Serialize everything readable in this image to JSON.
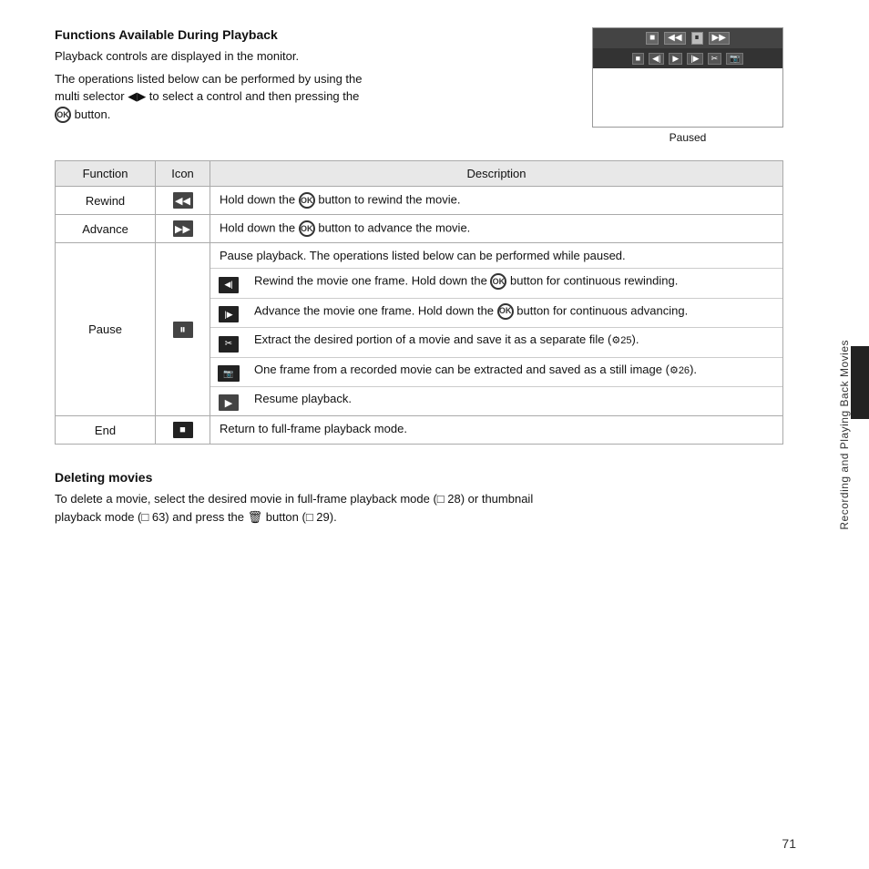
{
  "page": {
    "number": "71",
    "sidebar_text": "Recording and Playing Back Movies"
  },
  "section1": {
    "title": "Functions Available During Playback",
    "intro1": "Playback controls are displayed in the monitor.",
    "intro2": "The operations listed below can be performed by using the multi selector ◀▶ to select a control and then pressing the ® button.",
    "monitor_label": "Paused"
  },
  "table": {
    "headers": [
      "Function",
      "Icon",
      "Description"
    ],
    "rows": [
      {
        "function": "Rewind",
        "icon": "◀◀",
        "description": "Hold down the ® button to rewind the movie."
      },
      {
        "function": "Advance",
        "icon": "▶▶",
        "description": "Hold down the ® button to advance the movie."
      },
      {
        "function": "Pause",
        "icon": "⏸",
        "description_top": "Pause playback. The operations listed below can be performed while paused.",
        "sub_rows": [
          {
            "icon": "◀|",
            "desc": "Rewind the movie one frame. Hold down the ® button for continuous rewinding."
          },
          {
            "icon": "|▶",
            "desc": "Advance the movie one frame. Hold down the ® button for continuous advancing."
          },
          {
            "icon": "✂",
            "desc": "Extract the desired portion of a movie and save it as a separate file (🔗25)."
          },
          {
            "icon": "📷",
            "desc": "One frame from a recorded movie can be extracted and saved as a still image (🔗26)."
          },
          {
            "icon": "▶",
            "desc": "Resume playback."
          }
        ]
      },
      {
        "function": "End",
        "icon": "■",
        "description": "Return to full-frame playback mode."
      }
    ]
  },
  "section2": {
    "title": "Deleting movies",
    "text": "To delete a movie, select the desired movie in full-frame playback mode (□ 28) or thumbnail playback mode (□ 63) and press the 🗑 button (□ 29)."
  }
}
